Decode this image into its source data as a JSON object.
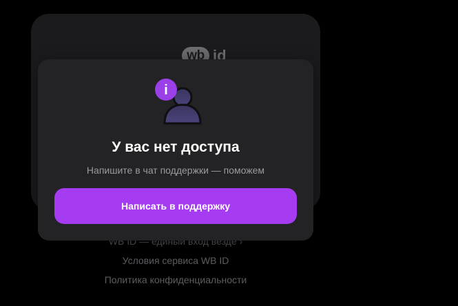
{
  "background_card": {
    "logo": {
      "wb": "wb",
      "id": "id"
    }
  },
  "footer_links": [
    {
      "label": "WB ID — единый вход везде ›"
    },
    {
      "label": "Условия сервиса WB ID"
    },
    {
      "label": "Политика конфиденциальности"
    }
  ],
  "modal": {
    "icon": "user-info-icon",
    "icon_badge": "i",
    "title": "У вас нет доступа",
    "subtitle": "Напишите в чат поддержки — поможем",
    "button_label": "Написать в поддержку"
  },
  "colors": {
    "page_background": "#000000",
    "card_background": "#1b1b1d",
    "modal_background": "#232325",
    "accent": "#a53cf1",
    "badge": "#9b3fe6"
  }
}
